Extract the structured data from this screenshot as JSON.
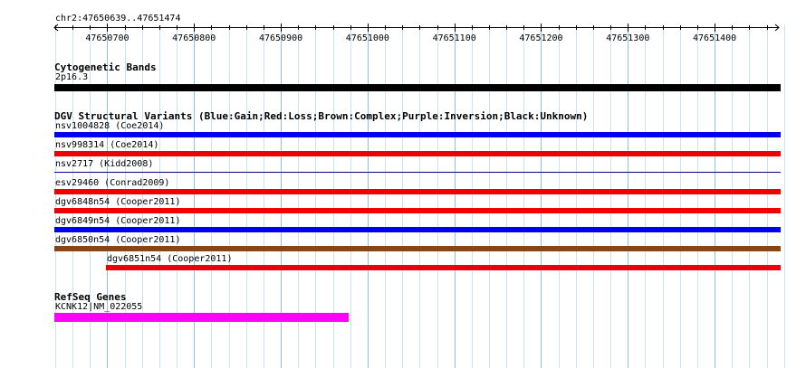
{
  "ruler": {
    "location": "chr2:47650639..47651474",
    "start": 47650639,
    "end": 47651474,
    "major_interval": 100,
    "minor_interval": 20,
    "labels": [
      "47650700",
      "47650800",
      "47650900",
      "47651000",
      "47651100",
      "47651200",
      "47651300",
      "47651400"
    ]
  },
  "tracks": {
    "cytoband": {
      "title": "Cytogenetic Bands",
      "features": [
        {
          "label": "2p16.3",
          "start": 47650639,
          "end": 47651474,
          "color": "#000000"
        }
      ]
    },
    "dgv": {
      "title": "DGV Structural Variants (Blue:Gain;Red:Loss;Brown:Complex;Purple:Inversion;Black:Unknown)",
      "features": [
        {
          "label": "nsv1004828 (Coe2014)",
          "start": 47650639,
          "end": 47651474,
          "color": "#0000ee",
          "thickness": 6
        },
        {
          "label": "nsv998314 (Coe2014)",
          "start": 47650639,
          "end": 47651474,
          "color": "#ee0000",
          "thickness": 6
        },
        {
          "label": "nsv2717 (Kidd2008)",
          "start": 47650639,
          "end": 47651474,
          "color": "#00008b",
          "thickness": 1
        },
        {
          "label": "esv29460 (Conrad2009)",
          "start": 47650639,
          "end": 47651474,
          "color": "#ee0000",
          "thickness": 6
        },
        {
          "label": "dgv6848n54 (Cooper2011)",
          "start": 47650639,
          "end": 47651474,
          "color": "#ee0000",
          "thickness": 6
        },
        {
          "label": "dgv6849n54 (Cooper2011)",
          "start": 47650639,
          "end": 47651474,
          "color": "#0000ee",
          "thickness": 6
        },
        {
          "label": "dgv6850n54 (Cooper2011)",
          "start": 47650639,
          "end": 47651474,
          "color": "#8b4513",
          "thickness": 6
        },
        {
          "label": "dgv6851n54 (Cooper2011)",
          "start": 47650698,
          "end": 47651474,
          "color": "#ee0000",
          "thickness": 6
        }
      ]
    },
    "refseq": {
      "title": "RefSeq Genes",
      "features": [
        {
          "label": "KCNK12|NM_022055",
          "start": 47650639,
          "end": 47650976,
          "color": "#ff00ff",
          "thickness": 10
        }
      ]
    }
  }
}
